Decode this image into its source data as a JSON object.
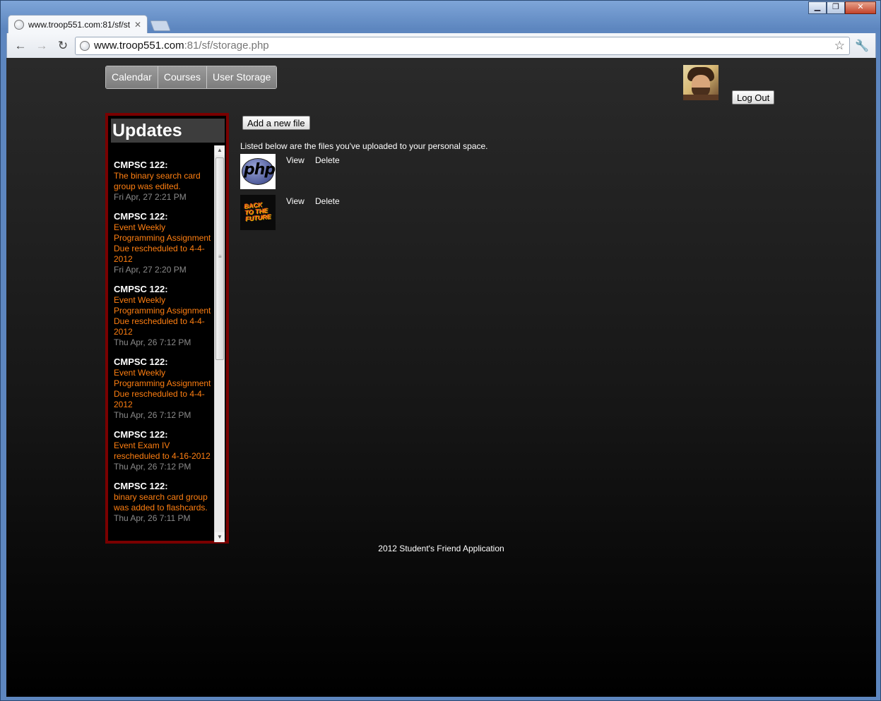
{
  "browser": {
    "tab_title": "www.troop551.com:81/sf/st",
    "url_host": "www.troop551.com",
    "url_path": ":81/sf/storage.php"
  },
  "nav": {
    "tabs": [
      {
        "label": "Calendar"
      },
      {
        "label": "Courses"
      },
      {
        "label": "User Storage"
      }
    ],
    "logout_label": "Log Out"
  },
  "updates": {
    "title": "Updates",
    "items": [
      {
        "course": "CMPSC 122:",
        "message": "The binary search card group was edited.",
        "time": "Fri Apr, 27 2:21 PM"
      },
      {
        "course": "CMPSC 122:",
        "message": "Event Weekly Programming Assignment Due rescheduled to 4-4-2012",
        "time": "Fri Apr, 27 2:20 PM"
      },
      {
        "course": "CMPSC 122:",
        "message": "Event Weekly Programming Assignment Due rescheduled to 4-4-2012",
        "time": "Thu Apr, 26 7:12 PM"
      },
      {
        "course": "CMPSC 122:",
        "message": "Event Weekly Programming Assignment Due rescheduled to 4-4-2012",
        "time": "Thu Apr, 26 7:12 PM"
      },
      {
        "course": "CMPSC 122:",
        "message": "Event Exam IV rescheduled to 4-16-2012",
        "time": "Thu Apr, 26 7:12 PM"
      },
      {
        "course": "CMPSC 122:",
        "message": "binary search card group was added to flashcards.",
        "time": "Thu Apr, 26 7:11 PM"
      }
    ]
  },
  "storage": {
    "add_button_label": "Add a new file",
    "intro_text": "Listed below are the files you've uploaded to your personal space.",
    "files": [
      {
        "thumb_text": "php",
        "view_label": "View",
        "delete_label": "Delete"
      },
      {
        "thumb_text": "BACK TO THE FUTURE",
        "view_label": "View",
        "delete_label": "Delete"
      }
    ]
  },
  "footer": {
    "text": "2012 Student's Friend Application"
  }
}
